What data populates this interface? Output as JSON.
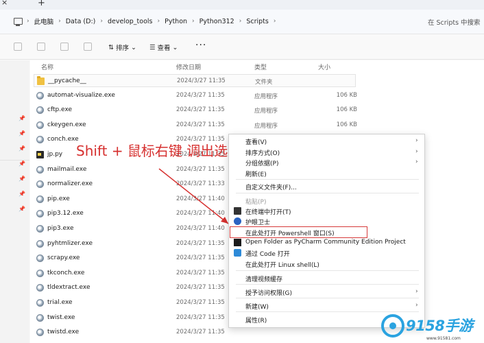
{
  "tabbar": {
    "close_glyph": "×",
    "new_tab_glyph": "+"
  },
  "breadcrumb": [
    "此电脑",
    "Data (D:)",
    "develop_tools",
    "Python",
    "Python312",
    "Scripts"
  ],
  "search": {
    "placeholder": "在 Scripts 中搜索"
  },
  "toolbar": {
    "sort_label": "排序",
    "view_label": "查看",
    "more_label": "···"
  },
  "columns": {
    "name": "名称",
    "date": "修改日期",
    "type": "类型",
    "size": "大小"
  },
  "files": [
    {
      "name": "__pycache__",
      "date": "2024/3/27 11:35",
      "type": "文件夹",
      "size": "",
      "icon": "folder-icon"
    },
    {
      "name": "automat-visualize.exe",
      "date": "2024/3/27 11:35",
      "type": "应用程序",
      "size": "106 KB",
      "icon": "exe-icon"
    },
    {
      "name": "cftp.exe",
      "date": "2024/3/27 11:35",
      "type": "应用程序",
      "size": "106 KB",
      "icon": "exe-icon"
    },
    {
      "name": "ckeygen.exe",
      "date": "2024/3/27 11:35",
      "type": "应用程序",
      "size": "106 KB",
      "icon": "exe-icon"
    },
    {
      "name": "conch.exe",
      "date": "2024/3/27 11:35",
      "type": "",
      "size": "",
      "icon": "exe-icon"
    },
    {
      "name": "jp.py",
      "date": "2024/3/27 11:35",
      "type": "",
      "size": "",
      "icon": "py-icon"
    },
    {
      "name": "mailmail.exe",
      "date": "2024/3/27 11:35",
      "type": "",
      "size": "",
      "icon": "exe-icon"
    },
    {
      "name": "normalizer.exe",
      "date": "2024/3/27 11:33",
      "type": "",
      "size": "",
      "icon": "exe-icon"
    },
    {
      "name": "pip.exe",
      "date": "2024/3/27 11:40",
      "type": "",
      "size": "",
      "icon": "exe-icon"
    },
    {
      "name": "pip3.12.exe",
      "date": "2024/3/27 11:40",
      "type": "",
      "size": "",
      "icon": "exe-icon"
    },
    {
      "name": "pip3.exe",
      "date": "2024/3/27 11:40",
      "type": "",
      "size": "",
      "icon": "exe-icon"
    },
    {
      "name": "pyhtmlizer.exe",
      "date": "2024/3/27 11:35",
      "type": "",
      "size": "",
      "icon": "exe-icon"
    },
    {
      "name": "scrapy.exe",
      "date": "2024/3/27 11:35",
      "type": "",
      "size": "",
      "icon": "exe-icon"
    },
    {
      "name": "tkconch.exe",
      "date": "2024/3/27 11:35",
      "type": "",
      "size": "",
      "icon": "exe-icon"
    },
    {
      "name": "tldextract.exe",
      "date": "2024/3/27 11:35",
      "type": "",
      "size": "",
      "icon": "exe-icon"
    },
    {
      "name": "trial.exe",
      "date": "2024/3/27 11:35",
      "type": "",
      "size": "",
      "icon": "exe-icon"
    },
    {
      "name": "twist.exe",
      "date": "2024/3/27 11:35",
      "type": "",
      "size": "",
      "icon": "exe-icon"
    },
    {
      "name": "twistd.exe",
      "date": "2024/3/27 11:35",
      "type": "",
      "size": "",
      "icon": "exe-icon"
    }
  ],
  "annotation": {
    "text": "Shift + 鼠标右键 调出选项栏",
    "color": "#d6302f"
  },
  "context_menu": {
    "view": "查看(V)",
    "sort_by": "排序方式(O)",
    "group_by": "分组依据(P)",
    "refresh": "刷新(E)",
    "customize": "自定义文件夹(F)...",
    "paste": "粘贴(P)",
    "open_terminal": "在终端中打开(T)",
    "huorong": "护眼卫士",
    "open_powershell": "在此处打开 Powershell 窗口(S)",
    "pycharm": "Open Folder as PyCharm Community Edition Project",
    "vscode": "通过 Code 打开",
    "linux_shell": "在此处打开 Linux shell(L)",
    "clear_cache": "清理视频缓存",
    "give_access": "授予访问权限(G)",
    "new": "新建(W)",
    "properties": "属性(R)"
  },
  "watermark": {
    "brand": "9158手游",
    "url": "www.91581.com"
  },
  "colors": {
    "accent": "#2ba3e0",
    "highlight": "#d63a3a"
  }
}
